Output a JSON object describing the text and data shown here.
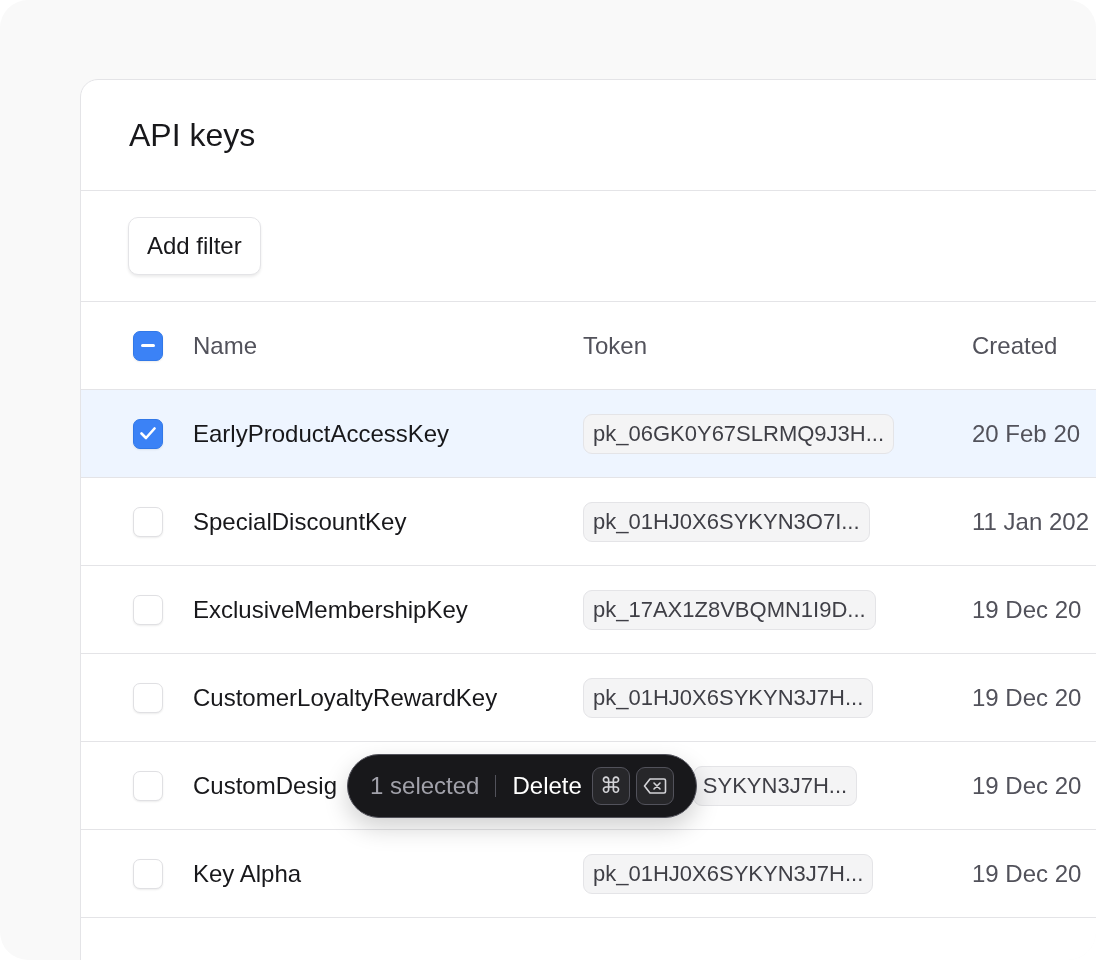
{
  "card": {
    "title": "API keys"
  },
  "filter_button": "Add filter",
  "table": {
    "select_all": {
      "indeterminate": true
    },
    "columns": [
      "Name",
      "Token",
      "Created"
    ],
    "rows": [
      {
        "kind": "plain",
        "selected": true,
        "name": "EarlyProductAccessKey",
        "token": "pk_06GK0Y67SLRMQ9J3H...",
        "created": "20 Feb 20"
      },
      {
        "kind": "plain",
        "selected": false,
        "name": "SpecialDiscountKey",
        "token": "pk_01HJ0X6SYKYN3O7I...",
        "created": "11 Jan 202"
      },
      {
        "kind": "plain",
        "selected": false,
        "name": "ExclusiveMembershipKey",
        "token": "pk_17AX1Z8VBQMN1I9D...",
        "created": "19 Dec 20"
      },
      {
        "kind": "plain",
        "selected": false,
        "name": "CustomerLoyaltyRewardKey",
        "token": "pk_01HJ0X6SYKYN3J7H...",
        "created": "19 Dec 20"
      },
      {
        "kind": "under-toolbar",
        "selected": false,
        "name": "CustomDesig",
        "token": "SYKYN3J7H...",
        "created": "19 Dec 20"
      },
      {
        "kind": "plain",
        "selected": false,
        "name": "Key Alpha",
        "token": "pk_01HJ0X6SYKYN3J7H...",
        "created": "19 Dec 20"
      }
    ]
  },
  "selection_bar": {
    "count": "1 selected",
    "action": "Delete",
    "shortcut_key": "⌘"
  }
}
